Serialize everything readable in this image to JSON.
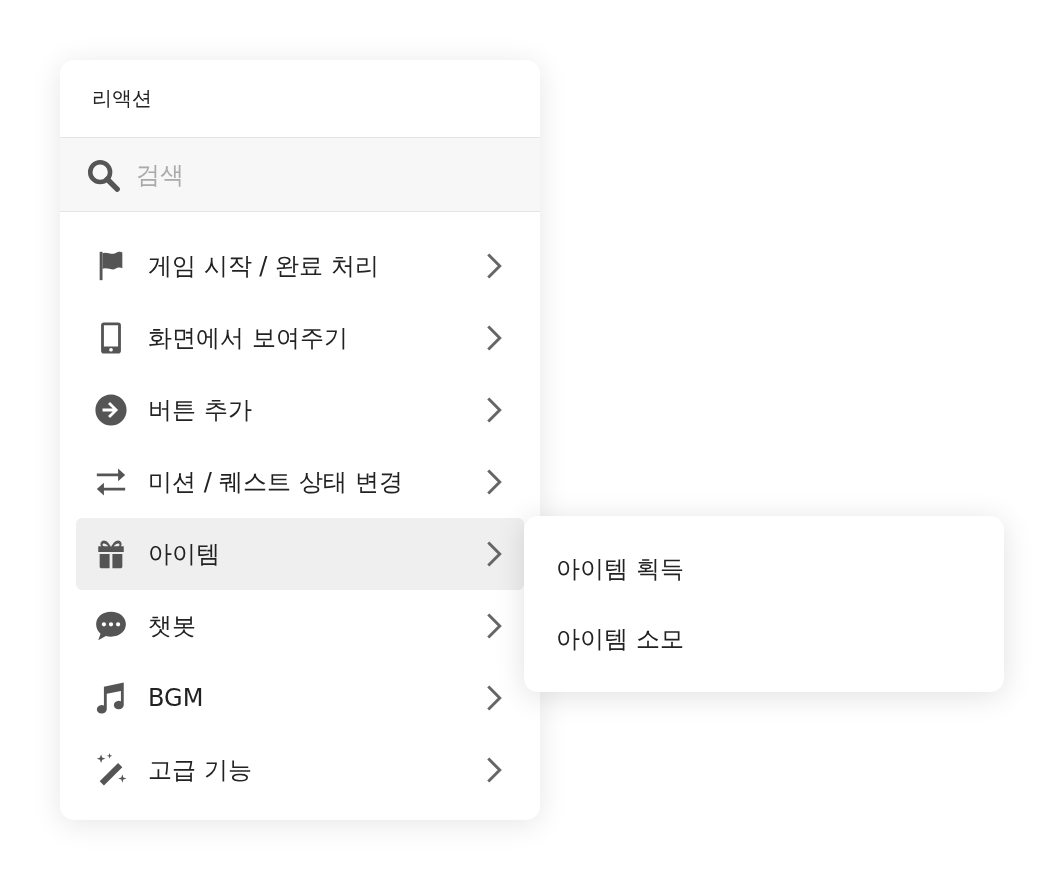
{
  "menu": {
    "title": "리액션",
    "search": {
      "placeholder": "검색"
    },
    "items": [
      {
        "label": "게임 시작 / 완료 처리",
        "selected": false
      },
      {
        "label": "화면에서 보여주기",
        "selected": false
      },
      {
        "label": "버튼 추가",
        "selected": false
      },
      {
        "label": "미션 / 퀘스트 상태 변경",
        "selected": false
      },
      {
        "label": "아이템",
        "selected": true
      },
      {
        "label": "챗봇",
        "selected": false
      },
      {
        "label": "BGM",
        "selected": false
      },
      {
        "label": "고급 기능",
        "selected": false
      }
    ]
  },
  "submenu": {
    "items": [
      "아이템 획득",
      "아이템 소모"
    ]
  }
}
